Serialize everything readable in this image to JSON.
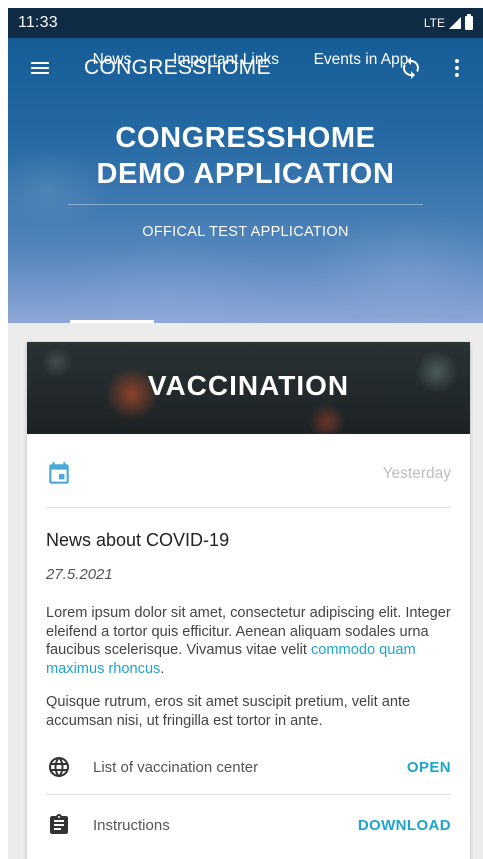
{
  "status_bar": {
    "time": "11:33",
    "network": "LTE"
  },
  "toolbar": {
    "title": "CONGRESSHOME",
    "menu_icon": "menu-icon",
    "sync_icon": "sync-icon",
    "more_icon": "more-vert-icon"
  },
  "hero": {
    "title_line1": "CONGRESSHOME",
    "title_line2": "DEMO APPLICATION",
    "subtitle": "OFFICAL TEST APPLICATION"
  },
  "tabs": [
    {
      "label": "News",
      "selected": true
    },
    {
      "label": "Important Links",
      "selected": false
    },
    {
      "label": "Events in App",
      "selected": false
    }
  ],
  "card": {
    "banner_title": "VACCINATION",
    "meta_icon": "calendar-icon",
    "meta_date": "Yesterday",
    "title": "News about COVID-19",
    "date": "27.5.2021",
    "body_text": "Lorem ipsum dolor sit amet, consectetur adipiscing elit. Integer eleifend a tortor quis efficitur. Aenean aliquam sodales urna faucibus scelerisque. Vivamus vitae velit ",
    "body_link": "commodo quam maximus rhoncus",
    "body_suffix": ".",
    "body2": "Quisque rutrum, eros sit amet suscipit pretium, velit ante accumsan nisi, ut fringilla est tortor in ante.",
    "actions": [
      {
        "icon": "globe-icon",
        "label": "List of vaccination center",
        "button": "OPEN"
      },
      {
        "icon": "clipboard-icon",
        "label": "Instructions",
        "button": "DOWNLOAD"
      }
    ]
  },
  "colors": {
    "accent": "#1ea4c9",
    "status_bar": "#0f2b45",
    "header": "#2a76b4"
  }
}
